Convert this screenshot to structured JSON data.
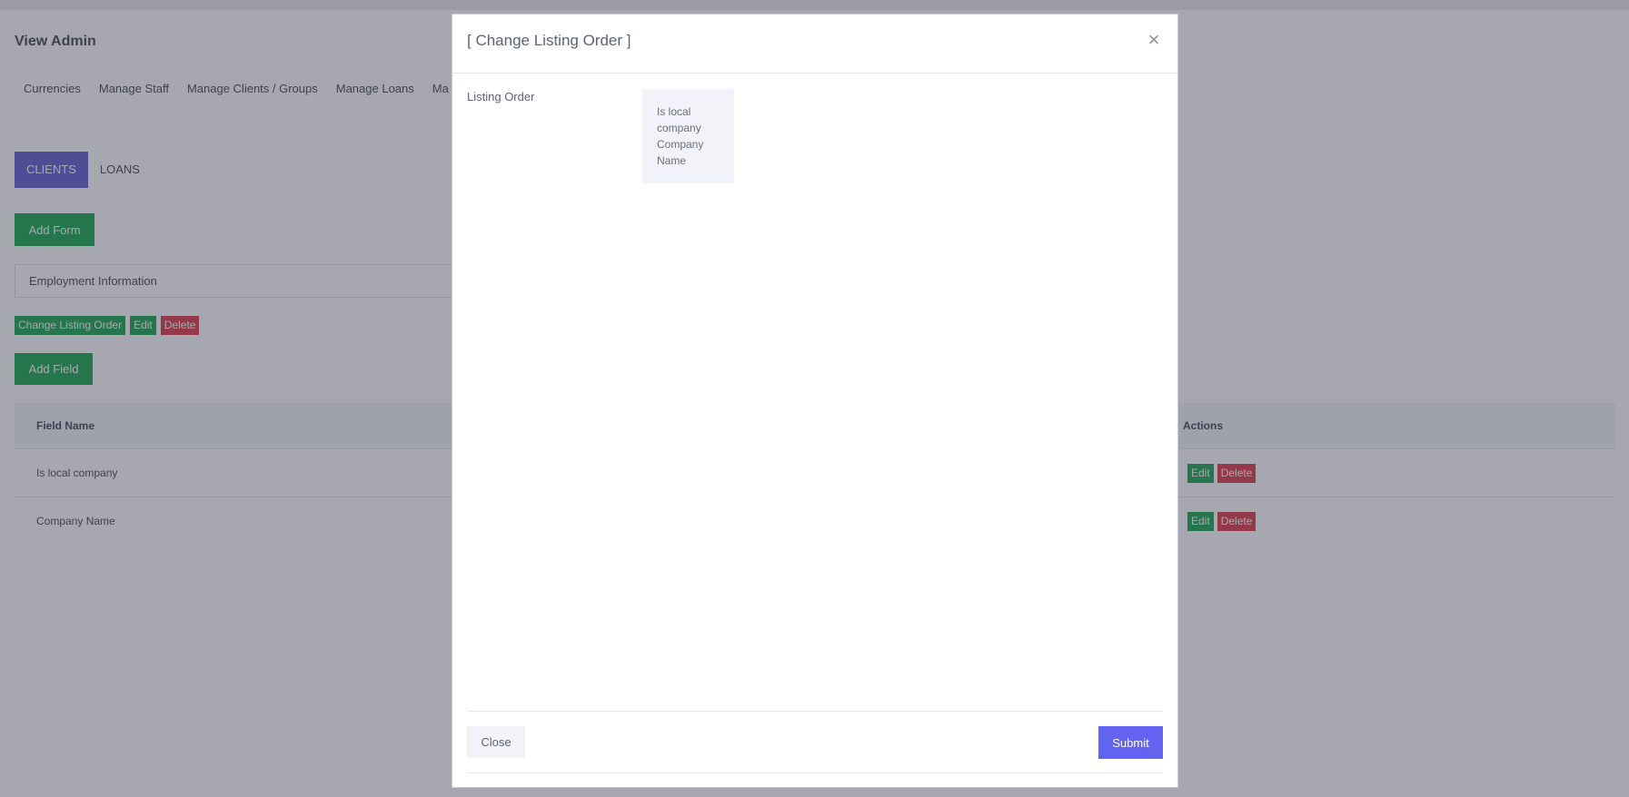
{
  "page": {
    "title": "View Admin",
    "nav": [
      "Currencies",
      "Manage Staff",
      "Manage Clients / Groups",
      "Manage Loans",
      "Ma"
    ],
    "tabs": [
      {
        "label": "CLIENTS",
        "active": true
      },
      {
        "label": "LOANS",
        "active": false
      }
    ],
    "add_form_label": "Add Form",
    "form_selected": "Employment Information",
    "form_actions": {
      "change_order_label": "Change Listing Order",
      "edit_label": "Edit",
      "delete_label": "Delete"
    },
    "add_field_label": "Add Field",
    "table": {
      "headers": {
        "name": "Field Name",
        "actions": "Actions"
      },
      "rows": [
        {
          "name": "Is local company",
          "edit": "Edit",
          "delete": "Delete"
        },
        {
          "name": "Company Name",
          "edit": "Edit",
          "delete": "Delete"
        }
      ]
    }
  },
  "modal": {
    "title": "[ Change Listing Order ]",
    "close_icon": "×",
    "field_label": "Listing Order",
    "items": [
      "Is local company",
      "Company Name"
    ],
    "close_label": "Close",
    "submit_label": "Submit"
  },
  "colors": {
    "primary": "#6363f2",
    "tab_active": "#5d5bd4",
    "success": "#14a44d",
    "danger": "#dc3545"
  }
}
